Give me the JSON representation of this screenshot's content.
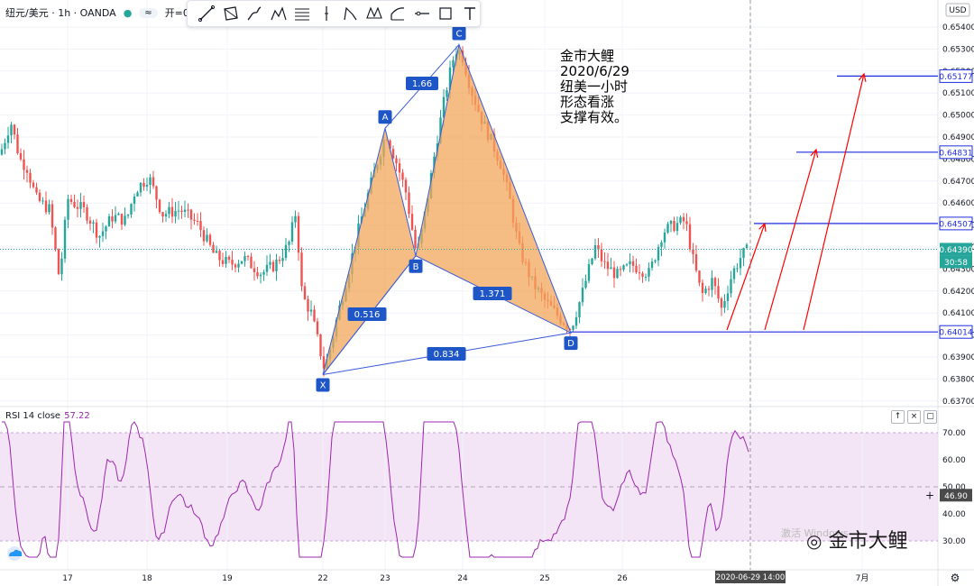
{
  "header": {
    "symbol": "纽元/美元 · 1h · OANDA",
    "toggle": "≈",
    "open_label": "开=0."
  },
  "note": {
    "lines": [
      "金市大鲤",
      "2020/6/29",
      "纽美一小时",
      "形态看涨",
      "支撑有效。"
    ]
  },
  "toolbar": {
    "tools": [
      "trend-line-icon",
      "rectangle-icon",
      "brush-icon",
      "pattern-icon",
      "fib-icon",
      "cursor-icon",
      "abcd-icon",
      "xabcd-icon",
      "ruler-icon",
      "horizontal-line-icon",
      "box-icon",
      "text-icon"
    ]
  },
  "price_axis": {
    "currency": "USD",
    "ticks": [
      "0.65400",
      "0.65300",
      "0.65200",
      "0.65100",
      "0.65000",
      "0.64900",
      "0.64800",
      "0.64700",
      "0.64600",
      "0.64500",
      "0.64400",
      "0.64300",
      "0.64200",
      "0.64100",
      "0.64000",
      "0.63900",
      "0.63800",
      "0.63700"
    ],
    "levels": [
      {
        "label": "0.65177",
        "price": 0.65177,
        "color": "#1f2de0",
        "from_date": "2020-06-27T20:00"
      },
      {
        "label": "0.64831",
        "price": 0.64831,
        "color": "#1f2de0",
        "from_date": "2020-06-27T10:00"
      },
      {
        "label": "0.64507",
        "price": 0.64507,
        "color": "#1f2de0",
        "from_date": "2020-06-27T01:00"
      },
      {
        "label": "0.64014",
        "price": 0.64014,
        "color": "#1f2de0",
        "from_date": "2020-06-25T08:00"
      }
    ],
    "current": {
      "label": "0.64390",
      "price": 0.6439,
      "color": "#26a69a"
    },
    "countdown": "30:58"
  },
  "time_axis": {
    "labels": [
      "17",
      "18",
      "19",
      "22",
      "23",
      "24",
      "25",
      "26",
      "29",
      "7月"
    ],
    "crosshair_label": "2020-06-29   14:00"
  },
  "pattern": {
    "points": [
      {
        "name": "X",
        "price": 0.6382
      },
      {
        "name": "A",
        "price": 0.6494
      },
      {
        "name": "B",
        "price": 0.6436
      },
      {
        "name": "C",
        "price": 0.6532
      },
      {
        "name": "D",
        "price": 0.6401
      }
    ],
    "ratios": [
      {
        "label": "1.66"
      },
      {
        "label": "0.516"
      },
      {
        "label": "1.371"
      },
      {
        "label": "0.834"
      }
    ],
    "fill_color": "#f2a65a"
  },
  "rsi": {
    "title": "RSI 14 close",
    "value": "57.22",
    "ticks": [
      "70.00",
      "60.00",
      "50.00",
      "40.00",
      "30.00"
    ],
    "marker": "46.90",
    "pane_buttons": [
      "↑",
      "×",
      "▢"
    ]
  },
  "watermark": {
    "text": "金市大鲤",
    "ghost": "激活 Windows"
  },
  "colors": {
    "up": "#26a69a",
    "down": "#ef5350",
    "level": "#1f2de0",
    "arrow": "#ff0000",
    "rsi_line": "#9c27b0",
    "rsi_band": "#f3e5f5"
  }
}
